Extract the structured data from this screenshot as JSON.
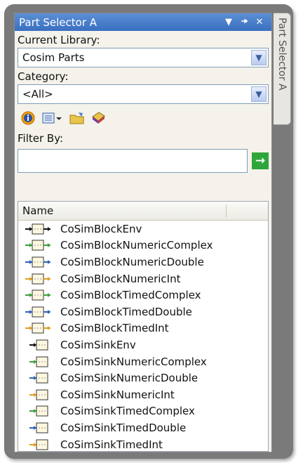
{
  "panel": {
    "title": "Part Selector A",
    "side_tab": "Part Selector A"
  },
  "library": {
    "label": "Current Library:",
    "value": "Cosim Parts"
  },
  "category": {
    "label": "Category:",
    "value": "<All>"
  },
  "filter": {
    "label": "Filter By:",
    "placeholder": "",
    "go": "→"
  },
  "list": {
    "header": "Name",
    "items": [
      {
        "label": "CoSimBlockEnv",
        "kind": "block",
        "color": "#111111"
      },
      {
        "label": "CoSimBlockNumericComplex",
        "kind": "block",
        "color": "#3aa038"
      },
      {
        "label": "CoSimBlockNumericDouble",
        "kind": "block",
        "color": "#2d5fb8"
      },
      {
        "label": "CoSimBlockNumericInt",
        "kind": "block",
        "color": "#e0a020"
      },
      {
        "label": "CoSimBlockTimedComplex",
        "kind": "block",
        "color": "#3aa038"
      },
      {
        "label": "CoSimBlockTimedDouble",
        "kind": "block",
        "color": "#2d5fb8"
      },
      {
        "label": "CoSimBlockTimedInt",
        "kind": "block",
        "color": "#e0a020"
      },
      {
        "label": "CoSimSinkEnv",
        "kind": "sink",
        "color": "#111111"
      },
      {
        "label": "CoSimSinkNumericComplex",
        "kind": "sink",
        "color": "#3aa038"
      },
      {
        "label": "CoSimSinkNumericDouble",
        "kind": "sink",
        "color": "#2d5fb8"
      },
      {
        "label": "CoSimSinkNumericInt",
        "kind": "sink",
        "color": "#e0a020"
      },
      {
        "label": "CoSimSinkTimedComplex",
        "kind": "sink",
        "color": "#3aa038"
      },
      {
        "label": "CoSimSinkTimedDouble",
        "kind": "sink",
        "color": "#2d5fb8"
      },
      {
        "label": "CoSimSinkTimedInt",
        "kind": "sink",
        "color": "#e0a020"
      }
    ]
  },
  "toolbar": {
    "icons": [
      "info-icon",
      "view-options-icon",
      "open-folder-icon",
      "library-icon"
    ]
  }
}
